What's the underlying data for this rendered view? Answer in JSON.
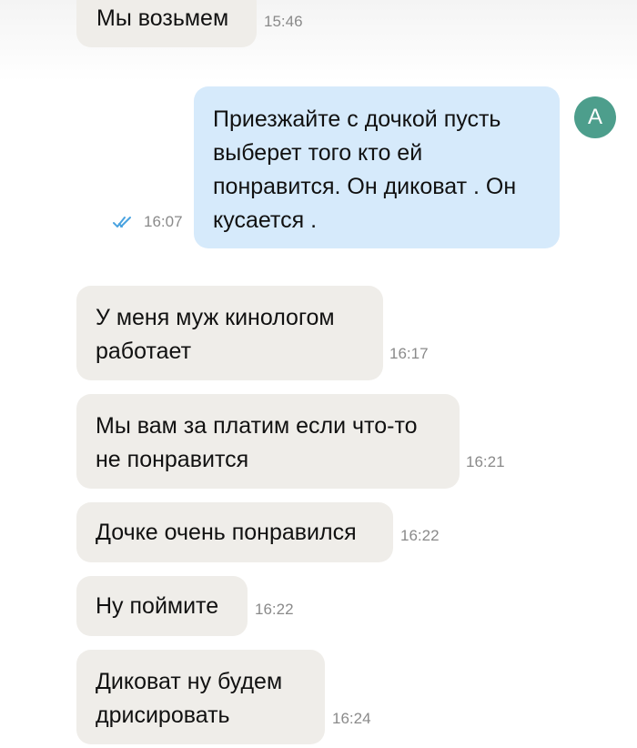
{
  "chat": {
    "messages": [
      {
        "direction": "incoming",
        "text": "Мы возьмем",
        "time": "15:46"
      },
      {
        "direction": "outgoing",
        "text": "Приезжайте с дочкой пусть выберет того кто ей понравится. Он диковат . Он кусается .",
        "time": "16:07",
        "status": "read"
      },
      {
        "direction": "incoming",
        "text": "У меня муж кинологом работает",
        "time": "16:17"
      },
      {
        "direction": "incoming",
        "text": "Мы вам за платим если что-то не понравится",
        "time": "16:21"
      },
      {
        "direction": "incoming",
        "text": "Дочке очень понравился",
        "time": "16:22"
      },
      {
        "direction": "incoming",
        "text": "Ну поймите",
        "time": "16:22"
      },
      {
        "direction": "incoming",
        "text": "Диковат ну будем дрисировать",
        "time": "16:24"
      }
    ],
    "avatar_letter": "А",
    "colors": {
      "incoming_bubble": "#efede9",
      "outgoing_bubble": "#d6eafb",
      "avatar": "#4d9e8c",
      "read_check": "#4aa3e0"
    },
    "icons": {
      "read_receipt": "double-check-icon"
    }
  }
}
